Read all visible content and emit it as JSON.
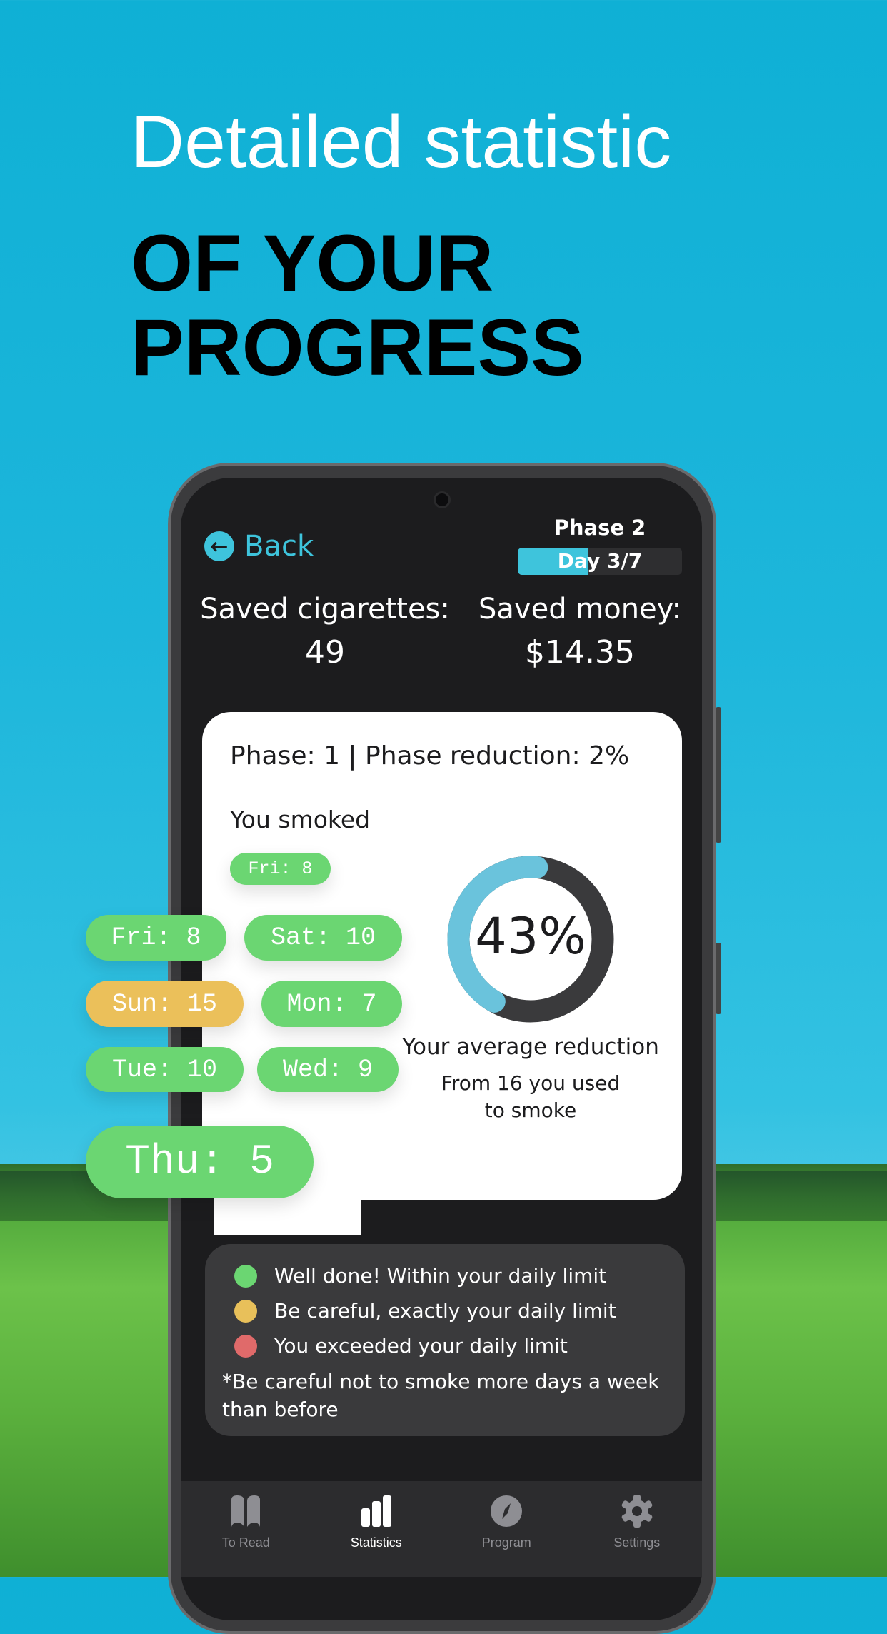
{
  "headline": {
    "line1": "Detailed statistic",
    "line2": "OF YOUR",
    "line3": "PROGRESS"
  },
  "header": {
    "back_label": "Back",
    "phase_label": "Phase 2",
    "day_label": "Day 3/7",
    "day_progress": 0.43,
    "accent_color": "#3ec4dc"
  },
  "stats": {
    "cigarettes_label": "Saved cigarettes:",
    "cigarettes_value": "49",
    "money_label": "Saved money:",
    "money_value": "$14.35"
  },
  "card": {
    "title": "Phase: 1 | Phase reduction: 2%",
    "smoked_label": "You smoked",
    "small_chip": "Fri: 8",
    "reduction_percent": "43%",
    "reduction_value": 43,
    "avg_label": "Your average reduction",
    "from_line1": "From 16 you used",
    "from_line2": "to smoke"
  },
  "days": [
    {
      "label": "Fri: 8",
      "status": "green"
    },
    {
      "label": "Sat: 10",
      "status": "green"
    },
    {
      "label": "Sun: 15",
      "status": "yellow"
    },
    {
      "label": "Mon: 7",
      "status": "green"
    },
    {
      "label": "Tue: 10",
      "status": "green"
    },
    {
      "label": "Wed: 9",
      "status": "green"
    },
    {
      "label": "Thu: 5",
      "status": "green"
    }
  ],
  "legend": {
    "items": [
      {
        "label": "Well done! Within your daily limit",
        "color": "#6bd672"
      },
      {
        "label": "Be careful, exactly your daily limit",
        "color": "#e8c05a"
      },
      {
        "label": "You exceeded your daily limit",
        "color": "#e06a6a"
      }
    ],
    "note_line1": "*Be careful not to smoke more days a week",
    "note_line2": "than before"
  },
  "tabs": [
    {
      "label": "To Read",
      "icon": "book-icon",
      "active": false
    },
    {
      "label": "Statistics",
      "icon": "bar-chart-icon",
      "active": true
    },
    {
      "label": "Program",
      "icon": "compass-icon",
      "active": false
    },
    {
      "label": "Settings",
      "icon": "gear-icon",
      "active": false
    }
  ]
}
